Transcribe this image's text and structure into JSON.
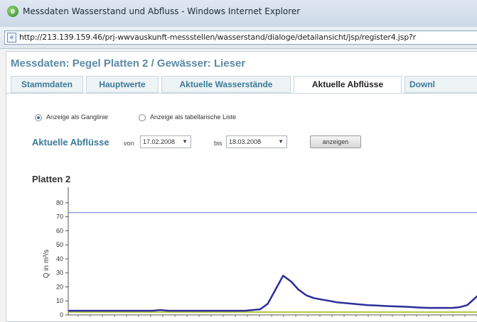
{
  "window": {
    "title": "Messdaten Wasserstand und Abfluss - Windows Internet Explorer",
    "url": "http://213.139.159.46/prj-wwvauskunft-messstellen/wasserstand/dialoge/detailansicht/jsp/register4.jsp?r"
  },
  "page": {
    "title": "Messdaten: Pegel Platten 2 / Gewässer: Lieser",
    "tabs": [
      {
        "label": "Stammdaten"
      },
      {
        "label": "Hauptwerte"
      },
      {
        "label": "Aktuelle Wasserstände"
      },
      {
        "label": "Aktuelle Abflüsse",
        "active": true
      },
      {
        "label": "Downl"
      }
    ]
  },
  "options": {
    "radio_hydrograph": "Anzeige als Ganglinie",
    "radio_table": "Anzeige als tabellarische Liste",
    "selected": "hydrograph"
  },
  "filter": {
    "title": "Aktuelle Abflüsse",
    "from_label": "von",
    "from_value": "17.02.2008",
    "to_label": "bis",
    "to_value": "18.03.2008",
    "button_label": "anzeigen"
  },
  "chart_data": {
    "type": "line",
    "title": "Platten 2",
    "ylabel": "Q in m³/s",
    "ylim": [
      0,
      85
    ],
    "yticks": [
      0,
      10,
      20,
      30,
      40,
      50,
      60,
      70,
      80
    ],
    "grid": false,
    "reference_lines": [
      {
        "value": 73,
        "color": "#6f72d8"
      },
      {
        "value": 2,
        "color": "#b6c94a"
      }
    ],
    "series": [
      {
        "color": "#2b2d9a",
        "values": [
          3,
          3,
          3,
          3,
          3,
          3,
          3,
          3,
          3,
          3,
          3,
          3,
          3.5,
          3,
          3,
          3,
          3,
          3,
          3,
          3,
          3,
          3,
          3,
          3,
          3.5,
          4,
          8,
          18,
          28,
          24,
          18,
          14,
          12,
          11,
          10,
          9,
          8.5,
          8,
          7.5,
          7,
          6.8,
          6.5,
          6.2,
          6,
          5.8,
          5.5,
          5.2,
          5,
          5,
          5,
          5,
          5.5,
          7,
          12,
          17
        ]
      }
    ]
  }
}
